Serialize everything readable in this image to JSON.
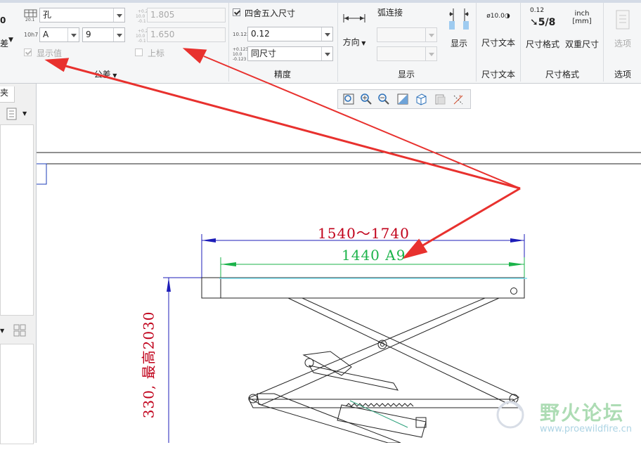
{
  "ribbon": {
    "tolerance": {
      "hole_label": "孔",
      "fit_letter": "A",
      "fit_grade": "9",
      "show_value_label": "显示值",
      "upper_value": "1.805",
      "lower_value": "1.650",
      "superscript_label": "上标",
      "group_label": "公差",
      "partial_left_label": "差"
    },
    "precision": {
      "round_label": "四舍五入尺寸",
      "decimal_value": "0.12",
      "same_dim_value": "同尺寸",
      "group_label": "精度"
    },
    "display": {
      "direction_label": "方向",
      "arc_label": "弧连接",
      "show_label": "显示",
      "group_label": "显示"
    },
    "dim_text": {
      "button_label": "尺寸文本",
      "icon_text": "ø10.0",
      "group_label": "尺寸文本"
    },
    "dim_format": {
      "format_label": "尺寸格式",
      "dual_label": "双重尺寸",
      "fraction_top": "0.12",
      "fraction_main": "5/8",
      "inch_label": "inch",
      "mm_label": "[mm]",
      "group_label": "尺寸格式"
    },
    "options": {
      "button_label": "选项",
      "group_label": "选项"
    }
  },
  "left_panel": {
    "tab_label": "夹"
  },
  "drawing": {
    "dim_top": "1540～1740",
    "dim_green": "1440 A9",
    "dim_vertical": "330, 最高2030",
    "colors": {
      "dim_red": "#c0001a",
      "dim_green": "#1bb34a",
      "dim_blue": "#0000cc",
      "arrow": "#e8312e"
    }
  },
  "watermark": {
    "title": "野火论坛",
    "url": "www.proewildfire.cn"
  }
}
